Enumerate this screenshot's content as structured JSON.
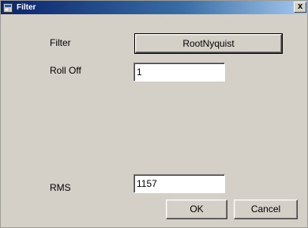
{
  "window": {
    "title": "Filter",
    "close_label": "x"
  },
  "form": {
    "filter_label": "Filter",
    "filter_value": "RootNyquist",
    "rolloff_label": "Roll Off",
    "rolloff_value": "1",
    "rms_label": "RMS",
    "rms_value": "1157"
  },
  "buttons": {
    "ok_label": "OK",
    "cancel_label": "Cancel"
  }
}
